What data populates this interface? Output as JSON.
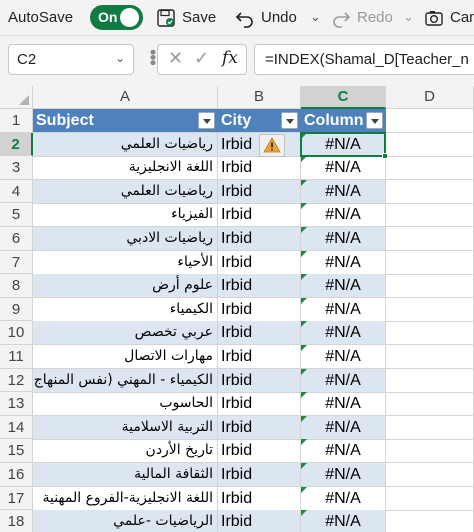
{
  "qat": {
    "autosave_label": "AutoSave",
    "toggle_state": "On",
    "save_label": "Save",
    "undo_label": "Undo",
    "redo_label": "Redo",
    "camera_label": "Cam"
  },
  "formula_bar": {
    "name_box": "C2",
    "formula": "=INDEX(Shamal_D[Teacher_n"
  },
  "sheet": {
    "columns": [
      "A",
      "B",
      "C",
      "D"
    ],
    "table_headers": {
      "subject": "Subject",
      "city": "City",
      "column": "Column"
    },
    "rows": [
      {
        "n": "1"
      },
      {
        "n": "2",
        "subject": "رياضيات العلمي",
        "city": "Irbid",
        "value": "#N/A"
      },
      {
        "n": "3",
        "subject": "اللغة الانجليزية",
        "city": "Irbid",
        "value": "#N/A"
      },
      {
        "n": "4",
        "subject": "رياضيات العلمي",
        "city": "Irbid",
        "value": "#N/A"
      },
      {
        "n": "5",
        "subject": "الفيزياء",
        "city": "Irbid",
        "value": "#N/A"
      },
      {
        "n": "6",
        "subject": "رياضيات الادبي",
        "city": "Irbid",
        "value": "#N/A"
      },
      {
        "n": "7",
        "subject": "الأحياء",
        "city": "Irbid",
        "value": "#N/A"
      },
      {
        "n": "8",
        "subject": "علوم أرض",
        "city": "Irbid",
        "value": "#N/A"
      },
      {
        "n": "9",
        "subject": "الكيمياء",
        "city": "Irbid",
        "value": "#N/A"
      },
      {
        "n": "10",
        "subject": "عربي تخصص",
        "city": "Irbid",
        "value": "#N/A"
      },
      {
        "n": "11",
        "subject": "مهارات الاتصال",
        "city": "Irbid",
        "value": "#N/A"
      },
      {
        "n": "12",
        "subject": "الكيمياء - المهني (نفس المنهاج",
        "city": "Irbid",
        "value": "#N/A"
      },
      {
        "n": "13",
        "subject": "الحاسوب",
        "city": "Irbid",
        "value": "#N/A"
      },
      {
        "n": "14",
        "subject": "التربية الاسلامية",
        "city": "Irbid",
        "value": "#N/A"
      },
      {
        "n": "15",
        "subject": "تاريخ الأردن",
        "city": "Irbid",
        "value": "#N/A"
      },
      {
        "n": "16",
        "subject": "الثقافة المالية",
        "city": "Irbid",
        "value": "#N/A"
      },
      {
        "n": "17",
        "subject": "اللغة الانجليزية-الفروع المهنية",
        "city": "Irbid",
        "value": "#N/A"
      },
      {
        "n": "18",
        "subject": "الرياضيات -علمي",
        "city": "Irbid",
        "value": "#N/A"
      }
    ]
  },
  "colors": {
    "accent": "#107c41",
    "table_header": "#4f81bd",
    "band": "#dce6f1",
    "error_flag": "#1e8a3e",
    "warning": "#e8a33d"
  },
  "icons": [
    "save-icon",
    "undo-icon",
    "redo-icon",
    "camera-icon",
    "warning-icon",
    "filter-dropdown-icon",
    "fx-icon"
  ]
}
